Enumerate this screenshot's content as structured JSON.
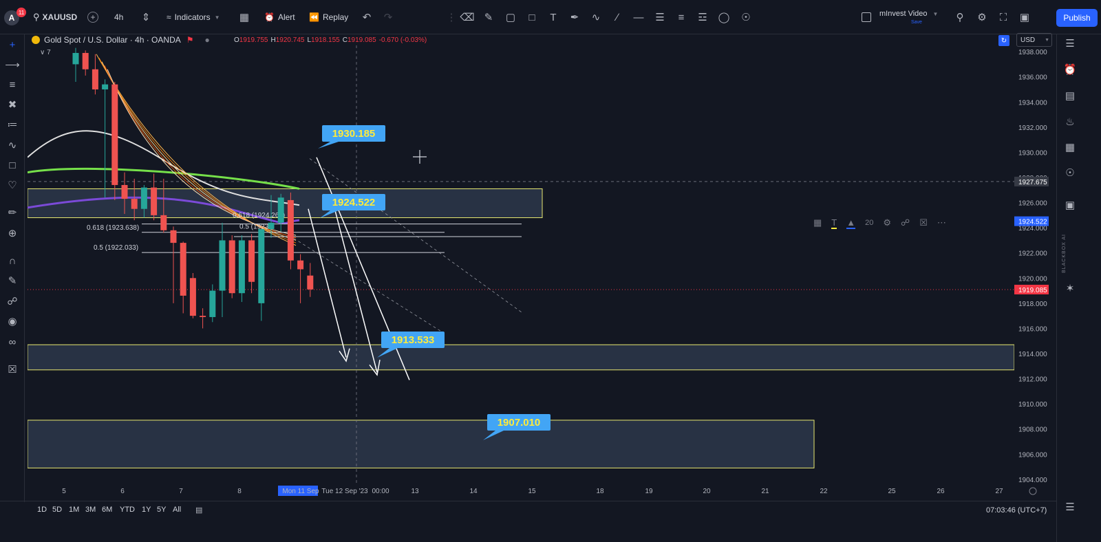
{
  "header": {
    "avatar_letter": "A",
    "notifications": "11",
    "symbol": "XAUUSD",
    "interval": "4h",
    "indicators_label": "Indicators",
    "alert_label": "Alert",
    "replay_label": "Replay",
    "layout_name": "mInvest Video",
    "save_label": "Save",
    "publish_label": "Publish"
  },
  "legend": {
    "title": "Gold Spot / U.S. Dollar · 4h · OANDA",
    "sub_count": "7",
    "open": "1919.755",
    "high": "1920.745",
    "low": "1918.155",
    "close": "1919.085",
    "change": "-0.670 (-0.03%)",
    "o_label": "O",
    "h_label": "H",
    "l_label": "L",
    "c_label": "C",
    "currency": "USD"
  },
  "chart_data": {
    "type": "candlestick",
    "y_ticks": [
      "1938.000",
      "1936.000",
      "1934.000",
      "1932.000",
      "1930.000",
      "1928.000",
      "1926.000",
      "1924.000",
      "1922.000",
      "1920.000",
      "1918.000",
      "1916.000",
      "1914.000",
      "1912.000",
      "1910.000",
      "1908.000",
      "1906.000",
      "1904.000"
    ],
    "ylim": [
      1903.5,
      1938.5
    ],
    "x_ticks": [
      "5",
      "6",
      "7",
      "8",
      "Mon 11 Sep",
      "Tue 12 Sep '23",
      "00:00",
      "13",
      "14",
      "15",
      "18",
      "19",
      "20",
      "21",
      "22",
      "25",
      "26",
      "27"
    ],
    "crosshair_price": "1927.675",
    "last_price": "1919.085",
    "marker_price": "1924.522",
    "callouts": [
      "1930.185",
      "1924.522",
      "1913.533",
      "1907.010"
    ],
    "fib_labels": [
      "0.618 (1923.638)",
      "0.5 (1922.033)",
      "0.618 (1924.263)",
      "0.5 (1923.4"
    ],
    "zones": [
      {
        "top": 1927.1,
        "bottom": 1924.8
      },
      {
        "top": 1914.7,
        "bottom": 1912.7
      },
      {
        "top": 1908.7,
        "bottom": 1904.9
      }
    ],
    "candles": [
      {
        "o": 1937.0,
        "h": 1938.3,
        "l": 1935.6,
        "c": 1937.9
      },
      {
        "o": 1937.9,
        "h": 1938.1,
        "l": 1936.1,
        "c": 1936.6
      },
      {
        "o": 1936.6,
        "h": 1937.8,
        "l": 1934.6,
        "c": 1935.0
      },
      {
        "o": 1935.0,
        "h": 1935.8,
        "l": 1926.4,
        "c": 1935.4
      },
      {
        "o": 1935.4,
        "h": 1935.6,
        "l": 1926.2,
        "c": 1927.4
      },
      {
        "o": 1927.4,
        "h": 1928.4,
        "l": 1925.1,
        "c": 1926.3
      },
      {
        "o": 1926.3,
        "h": 1927.9,
        "l": 1924.6,
        "c": 1925.5
      },
      {
        "o": 1925.5,
        "h": 1927.4,
        "l": 1924.8,
        "c": 1927.2
      },
      {
        "o": 1927.2,
        "h": 1928.3,
        "l": 1924.6,
        "c": 1925.0
      },
      {
        "o": 1925.0,
        "h": 1927.9,
        "l": 1923.6,
        "c": 1923.8
      },
      {
        "o": 1923.8,
        "h": 1924.1,
        "l": 1918.0,
        "c": 1922.8
      },
      {
        "o": 1922.8,
        "h": 1922.9,
        "l": 1917.2,
        "c": 1918.6
      },
      {
        "o": 1920.0,
        "h": 1920.4,
        "l": 1916.8,
        "c": 1917.0
      },
      {
        "o": 1917.0,
        "h": 1917.6,
        "l": 1916.0,
        "c": 1916.9
      },
      {
        "o": 1916.9,
        "h": 1919.5,
        "l": 1916.5,
        "c": 1919.0
      },
      {
        "o": 1919.0,
        "h": 1924.4,
        "l": 1916.9,
        "c": 1923.0
      },
      {
        "o": 1923.0,
        "h": 1923.4,
        "l": 1918.4,
        "c": 1918.8
      },
      {
        "o": 1918.8,
        "h": 1923.4,
        "l": 1918.1,
        "c": 1923.0
      },
      {
        "o": 1923.0,
        "h": 1923.5,
        "l": 1918.8,
        "c": 1919.7
      },
      {
        "o": 1918.0,
        "h": 1923.9,
        "l": 1916.6,
        "c": 1923.9
      },
      {
        "o": 1923.9,
        "h": 1926.6,
        "l": 1923.2,
        "c": 1924.4
      },
      {
        "o": 1924.4,
        "h": 1926.7,
        "l": 1923.7,
        "c": 1926.4
      },
      {
        "o": 1926.2,
        "h": 1926.8,
        "l": 1920.7,
        "c": 1921.4
      },
      {
        "o": 1921.4,
        "h": 1921.9,
        "l": 1918.0,
        "c": 1920.7
      },
      {
        "o": 1920.2,
        "h": 1921.2,
        "l": 1918.5,
        "c": 1919.1
      }
    ]
  },
  "bottom": {
    "timeframes": [
      "1D",
      "5D",
      "1M",
      "3M",
      "6M",
      "YTD",
      "1Y",
      "5Y",
      "All"
    ],
    "clock": "07:03:46 (UTC+7)"
  },
  "sidebar_label": "BLACKBOX AI",
  "float_toolbar_width": "20"
}
